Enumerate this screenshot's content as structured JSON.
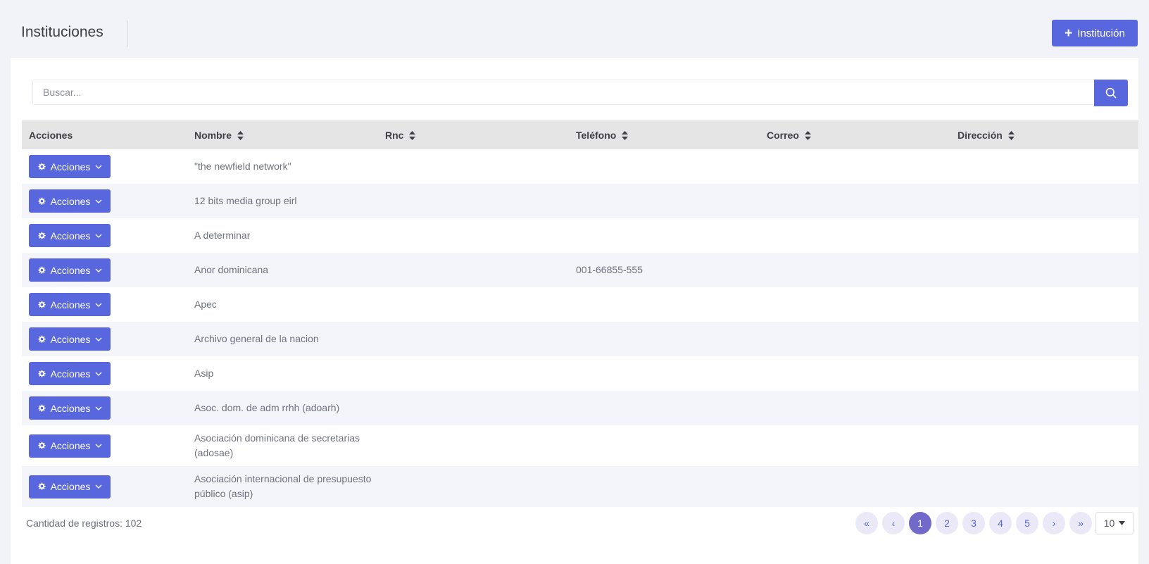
{
  "header": {
    "title": "Instituciones",
    "add_button_label": "Institución"
  },
  "search": {
    "placeholder": "Buscar..."
  },
  "table": {
    "columns": [
      "Acciones",
      "Nombre",
      "Rnc",
      "Teléfono",
      "Correo",
      "Dirección"
    ],
    "action_label": "Acciones",
    "rows": [
      {
        "nombre": "\"the newfield network\"",
        "rnc": "",
        "telefono": "",
        "correo": "",
        "direccion": ""
      },
      {
        "nombre": "12 bits media group eirl",
        "rnc": "",
        "telefono": "",
        "correo": "",
        "direccion": ""
      },
      {
        "nombre": "A determinar",
        "rnc": "",
        "telefono": "",
        "correo": "",
        "direccion": ""
      },
      {
        "nombre": "Anor dominicana",
        "rnc": "",
        "telefono": "001-66855-555",
        "correo": "",
        "direccion": ""
      },
      {
        "nombre": "Apec",
        "rnc": "",
        "telefono": "",
        "correo": "",
        "direccion": ""
      },
      {
        "nombre": "Archivo general de la nacion",
        "rnc": "",
        "telefono": "",
        "correo": "",
        "direccion": ""
      },
      {
        "nombre": "Asip",
        "rnc": "",
        "telefono": "",
        "correo": "",
        "direccion": ""
      },
      {
        "nombre": "Asoc. dom. de adm rrhh (adoarh)",
        "rnc": "",
        "telefono": "",
        "correo": "",
        "direccion": ""
      },
      {
        "nombre": "Asociación dominicana de secretarias (adosae)",
        "rnc": "",
        "telefono": "",
        "correo": "",
        "direccion": ""
      },
      {
        "nombre": "Asociación internacional de presupuesto público (asip)",
        "rnc": "",
        "telefono": "",
        "correo": "",
        "direccion": ""
      }
    ]
  },
  "footer": {
    "record_count_label": "Cantidad de registros: 102",
    "pagination": {
      "first": "«",
      "prev": "‹",
      "pages": [
        "1",
        "2",
        "3",
        "4",
        "5"
      ],
      "active_page": "1",
      "next": "›",
      "last": "»"
    },
    "page_size": "10"
  },
  "colors": {
    "primary": "#5867dd",
    "active_page": "#716aca",
    "page_background": "#f2f3f8",
    "table_header": "#e5e5e5",
    "row_stripe": "#f4f5fb"
  }
}
